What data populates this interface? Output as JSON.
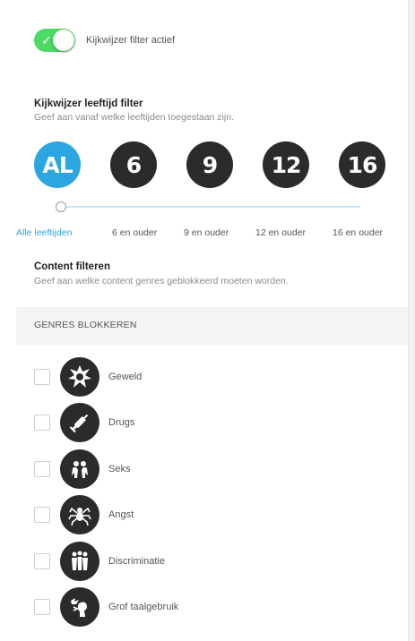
{
  "filter": {
    "toggle_on": true,
    "toggle_label": "Kijkwijzer filter actief"
  },
  "age_filter": {
    "title": "Kijkwijzer leeftijd filter",
    "description": "Geef aan vanaf welke leeftijden toegestaan zijn.",
    "ratings": [
      {
        "badge": "AL",
        "label": "Alle leeftijden",
        "active": true
      },
      {
        "badge": "6",
        "label": "6 en ouder",
        "active": false
      },
      {
        "badge": "9",
        "label": "9 en ouder",
        "active": false
      },
      {
        "badge": "12",
        "label": "12 en ouder",
        "active": false
      },
      {
        "badge": "16",
        "label": "16 en ouder",
        "active": false
      }
    ],
    "selected_index": 0
  },
  "content_filter": {
    "title": "Content filteren",
    "description": "Geef aan welke content genres geblokkeerd moeten worden."
  },
  "genres": {
    "header": "GENRES BLOKKEREN",
    "items": [
      {
        "label": "Geweld",
        "icon": "violence-icon",
        "checked": false
      },
      {
        "label": "Drugs",
        "icon": "drugs-icon",
        "checked": false
      },
      {
        "label": "Seks",
        "icon": "sex-icon",
        "checked": false
      },
      {
        "label": "Angst",
        "icon": "fear-icon",
        "checked": false
      },
      {
        "label": "Discriminatie",
        "icon": "discrimination-icon",
        "checked": false
      },
      {
        "label": "Grof taalgebruik",
        "icon": "coarse-language-icon",
        "checked": false
      }
    ]
  },
  "colors": {
    "accent": "#2ba6e0",
    "toggle_on": "#4cd964",
    "badge": "#2b2b2b"
  }
}
